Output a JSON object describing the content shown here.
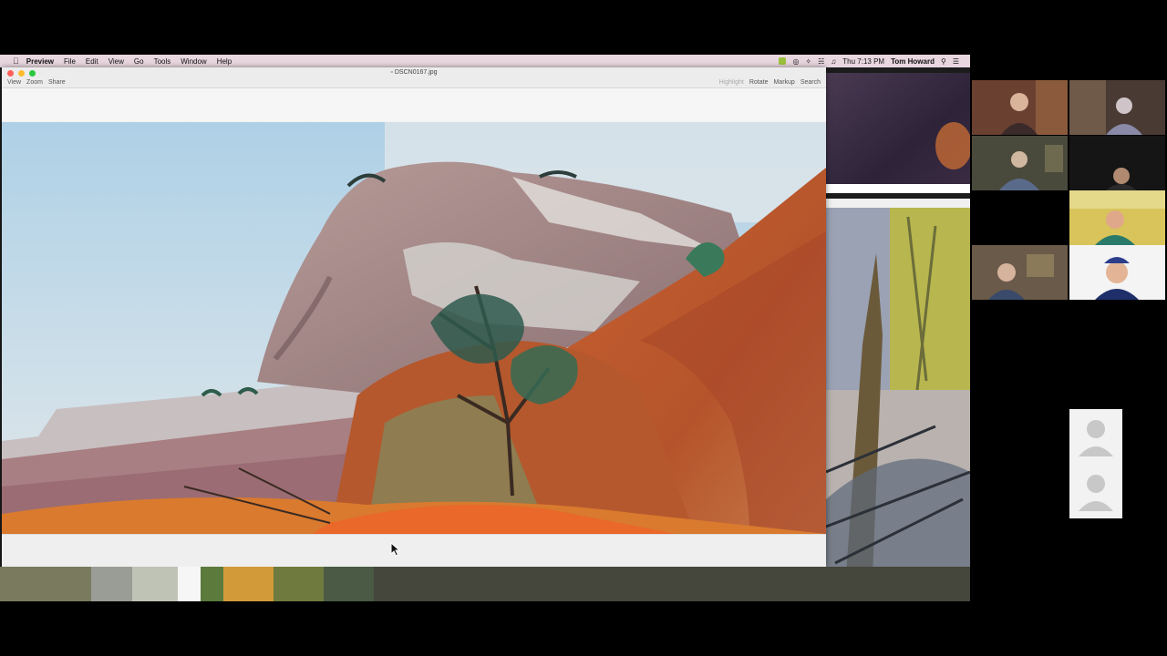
{
  "menubar": {
    "app_name": "Preview",
    "menus": [
      "File",
      "Edit",
      "View",
      "Go",
      "Tools",
      "Window",
      "Help"
    ],
    "clock": "Thu 7:13 PM",
    "user": "Tom Howard"
  },
  "window": {
    "title": "DSCN0167.jpg",
    "left_tools": [
      "View",
      "Zoom",
      "Share"
    ],
    "right_tools": [
      "Highlight",
      "Rotate",
      "Markup",
      "Search"
    ]
  },
  "colors": {
    "menubar": "#e9d7e0",
    "close": "#fd5f57",
    "minimize": "#fdbc2e",
    "zoom": "#2ac840"
  },
  "participants": {
    "count": 8,
    "video_off_count": 2
  }
}
